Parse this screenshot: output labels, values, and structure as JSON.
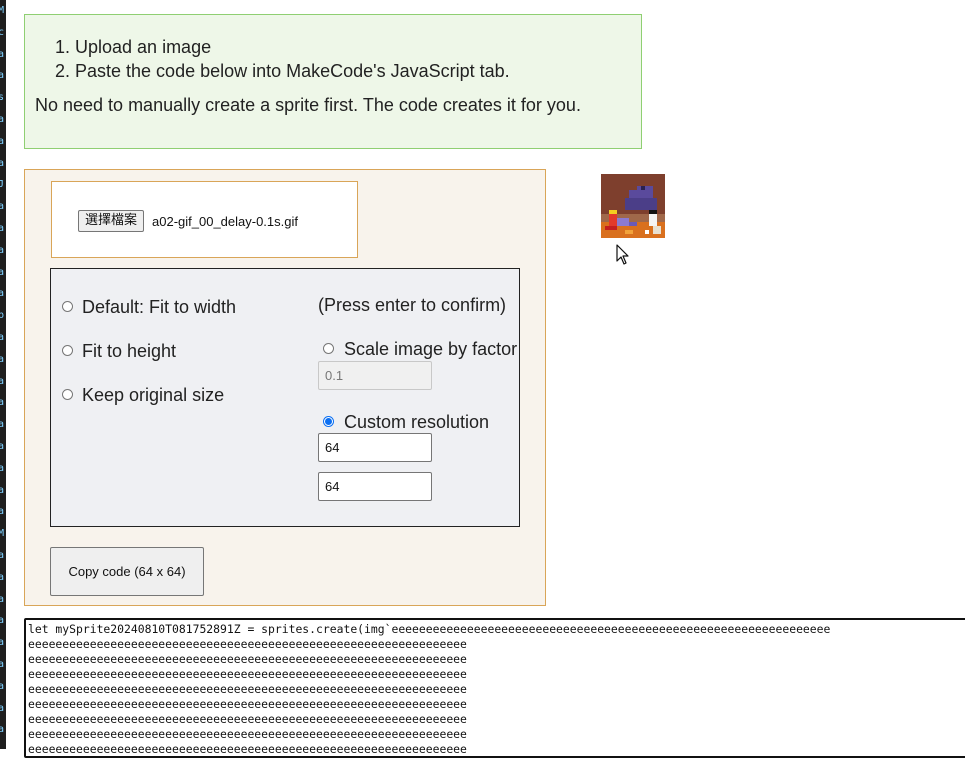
{
  "instructions": {
    "steps": [
      "Upload an image",
      "Paste the code below into MakeCode's JavaScript tab."
    ],
    "note": "No need to manually create a sprite first. The code creates it for you."
  },
  "file_input": {
    "button_label": "選擇檔案",
    "file_name": "a02-gif_00_delay-0.1s.gif"
  },
  "options": {
    "fit_width": "Default: Fit to width",
    "fit_height": "Fit to height",
    "keep_original": "Keep original size",
    "press_enter": "(Press enter to confirm)",
    "scale_label": "Scale image by factor",
    "scale_value": "0.1",
    "custom_label": "Custom resolution",
    "width_value": "64",
    "height_value": "64",
    "selected": "custom"
  },
  "copy_button": "Copy code (64 x 64)",
  "code": {
    "lines": [
      "let mySprite20240810T081752891Z = sprites.create(img`eeeeeeeeeeeeeeeeeeeeeeeeeeeeeeeeeeeeeeeeeeeeeeeeeeeeeeeeeeeeeeee",
      "eeeeeeeeeeeeeeeeeeeeeeeeeeeeeeeeeeeeeeeeeeeeeeeeeeeeeeeeeeeeeeee",
      "eeeeeeeeeeeeeeeeeeeeeeeeeeeeeeeeeeeeeeeeeeeeeeeeeeeeeeeeeeeeeeee",
      "eeeeeeeeeeeeeeeeeeeeeeeeeeeeeeeeeeeeeeeeeeeeeeeeeeeeeeeeeeeeeeee",
      "eeeeeeeeeeeeeeeeeeeeeeeeeeeeeeeeeeeeeeeeeeeeeeeeeeeeeeeeeeeeeeee",
      "eeeeeeeeeeeeeeeeeeeeeeeeeeeeeeeeeeeeeeeeeeeeeeeeeeeeeeeeeeeeeeee",
      "eeeeeeeeeeeeeeeeeeeeeeeeeeeeeeeeeeeeeeeeeeeeeeeeeeeeeeeeeeeeeeee",
      "eeeeeeeeeeeeeeeeeeeeeeeeeeeeeeeeeeeeeeeeeeeeeeeeeeeeeeeeeeeeeeee",
      "eeeeeeeeeeeeeeeeeeeeeeeeeeeeeeeeeeeeeeeeeeeeeeeeeeeeeeeeeeeeeeee"
    ]
  },
  "colors": {
    "instructions_bg": "#eef7e8",
    "instructions_border": "#8fcf72",
    "panel_bg": "#f8f3ec",
    "panel_border": "#d9a558",
    "radio_accent": "#0b6ff2",
    "preview_bg": "#7e3f2d"
  },
  "icons": {
    "cursor": "mouse-pointer-icon"
  }
}
